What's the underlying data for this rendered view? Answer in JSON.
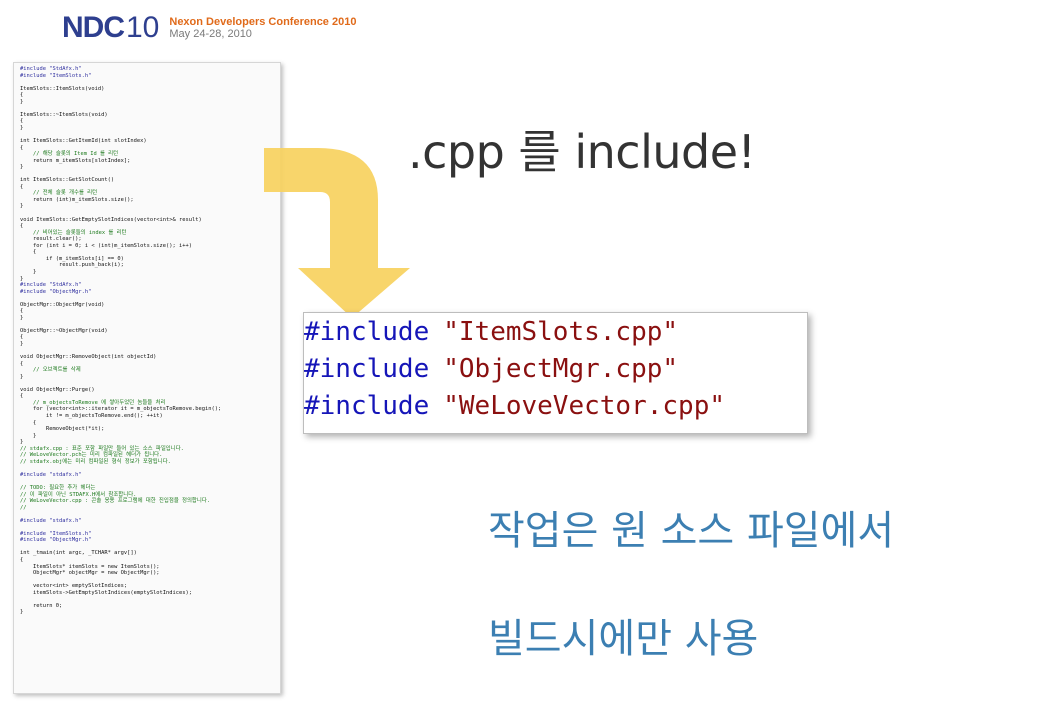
{
  "header": {
    "logo_mark": "NDC",
    "logo_number": "10",
    "conference_name": "Nexon Developers Conference 2010",
    "conference_dates": "May 24-28, 2010"
  },
  "slide": {
    "title": ".cpp 를 include!",
    "includes": [
      {
        "directive": "#include",
        "file": "\"ItemSlots.cpp\""
      },
      {
        "directive": "#include",
        "file": "\"ObjectMgr.cpp\""
      },
      {
        "directive": "#include",
        "file": "\"WeLoveVector.cpp\""
      }
    ],
    "notes": [
      "작업은 원 소스 파일에서",
      "빌드시에만 사용"
    ]
  },
  "code_lines": [
    "#include \"StdAfx.h\"",
    "#include \"ItemSlots.h\"",
    "",
    "ItemSlots::ItemSlots(void)",
    "{",
    "}",
    "",
    "ItemSlots::~ItemSlots(void)",
    "{",
    "}",
    "",
    "int ItemSlots::GetItemId(int slotIndex)",
    "{",
    "    // 해당 슬롯의 Item Id 를 리턴",
    "    return m_itemSlots[slotIndex];",
    "}",
    "",
    "int ItemSlots::GetSlotCount()",
    "{",
    "    // 전체 슬롯 개수를 리턴",
    "    return (int)m_itemSlots.size();",
    "}",
    "",
    "void ItemSlots::GetEmptySlotIndices(vector<int>& result)",
    "{",
    "    // 비어있는 슬롯들의 index 를 리턴",
    "    result.clear();",
    "    for (int i = 0; i < (int)m_itemSlots.size(); i++)",
    "    {",
    "        if (m_itemSlots[i] == 0)",
    "            result.push_back(i);",
    "    }",
    "}",
    "#include \"StdAfx.h\"",
    "#include \"ObjectMgr.h\"",
    "",
    "ObjectMgr::ObjectMgr(void)",
    "{",
    "}",
    "",
    "ObjectMgr::~ObjectMgr(void)",
    "{",
    "}",
    "",
    "void ObjectMgr::RemoveObject(int objectId)",
    "{",
    "    // 오브젝트를 삭제",
    "}",
    "",
    "void ObjectMgr::Purge()",
    "{",
    "    // m_objectsToRemove 에 쌓아두었던 놈들을 처리",
    "    for (vector<int>::iterator it = m_objectsToRemove.begin();",
    "        it != m_objectsToRemove.end(); ++it)",
    "    {",
    "        RemoveObject(*it);",
    "    }",
    "}",
    "// stdafx.cpp : 표준 포함 파일만 들어 있는 소스 파일입니다.",
    "// WeLoveVector.pch는 미리 컴파일된 헤더가 됩니다.",
    "// stdafx.obj에는 미리 컴파일된 형식 정보가 포함됩니다.",
    "",
    "#include \"stdafx.h\"",
    "",
    "// TODO: 필요한 추가 헤더는",
    "// 이 파일이 아닌 STDAFX.H에서 참조합니다.",
    "// WeLoveVector.cpp : 콘솔 응용 프로그램에 대한 진입점을 정의합니다.",
    "//",
    "",
    "#include \"stdafx.h\"",
    "",
    "#include \"ItemSlots.h\"",
    "#include \"ObjectMgr.h\"",
    "",
    "int _tmain(int argc, _TCHAR* argv[])",
    "{",
    "    ItemSlots* itemSlots = new ItemSlots();",
    "    ObjectMgr* objectMgr = new ObjectMgr();",
    "",
    "    vector<int> emptySlotIndices;",
    "    itemSlots->GetEmptySlotIndices(emptySlotIndices);",
    "",
    "    return 0;",
    "}"
  ],
  "colors": {
    "logo_blue": "#2e3f8f",
    "logo_orange": "#e06a1a",
    "arrow_fill": "#f7d15e",
    "note_blue": "#3c7fb2",
    "code_keyword": "#1515b8",
    "code_string": "#8a1010",
    "code_comment": "#1d7a1d"
  },
  "icons": {
    "arrow": "curved-down-arrow-icon"
  }
}
